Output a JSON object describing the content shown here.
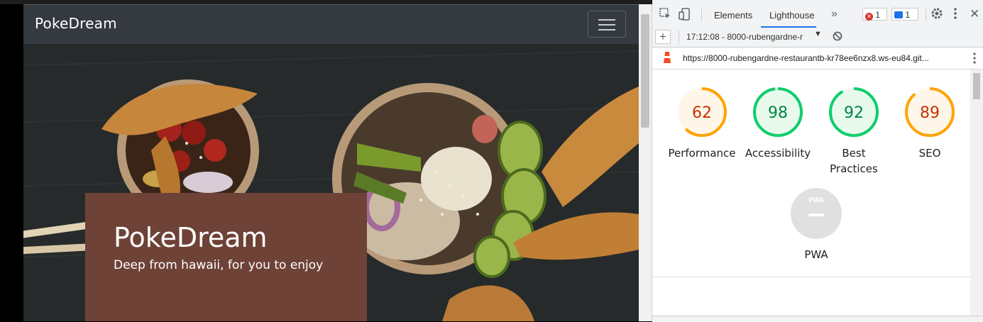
{
  "site": {
    "brand": "PokeDream",
    "hero": {
      "title": "PokeDream",
      "subtitle": "Deep from hawaii, for you to enjoy"
    },
    "colors": {
      "navbar": "#343a40",
      "caption": "#6e4237"
    }
  },
  "devtools": {
    "tabs": {
      "elements": "Elements",
      "lighthouse": "Lighthouse",
      "more": "»"
    },
    "badges": {
      "errors": "1",
      "messages": "1"
    },
    "toolbar": {
      "add": "+",
      "report_selector": "17:12:08 - 8000-rubengardne-r"
    },
    "url": "https://8000-rubengardne-restaurantb-kr78ee6nzx8.ws-eu84.git...",
    "scores": [
      {
        "label": "Performance",
        "score": 62,
        "color": "#ffa400"
      },
      {
        "label": "Accessibility",
        "score": 98,
        "color": "#0cce6b"
      },
      {
        "label": "Best Practices",
        "score": 92,
        "color": "#0cce6b"
      },
      {
        "label": "SEO",
        "score": 89,
        "color": "#ffa400"
      }
    ],
    "pwa": {
      "badge": "PWA",
      "label": "PWA"
    }
  }
}
